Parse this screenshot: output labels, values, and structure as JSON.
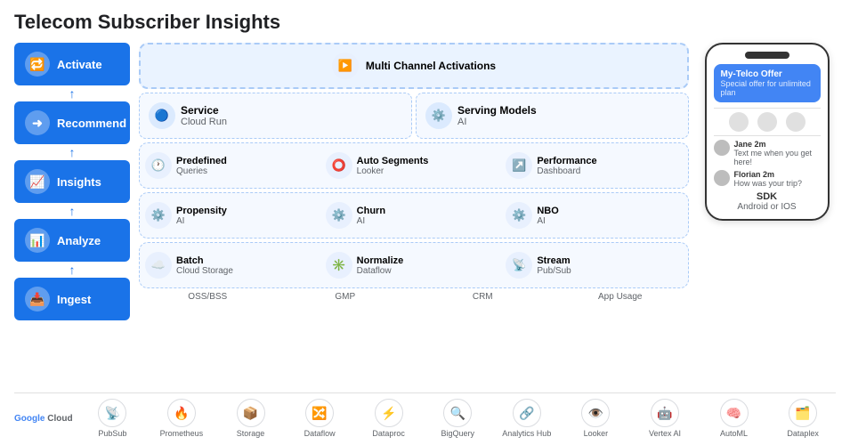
{
  "title": "Telecom Subscriber Insights",
  "sidebar": {
    "buttons": [
      {
        "label": "Activate",
        "icon": "🔁",
        "id": "activate"
      },
      {
        "label": "Recommend",
        "icon": "➜",
        "id": "recommend"
      },
      {
        "label": "Insights",
        "icon": "📈",
        "id": "insights"
      },
      {
        "label": "Analyze",
        "icon": "📊",
        "id": "analyze"
      },
      {
        "label": "Ingest",
        "icon": "📥",
        "id": "ingest"
      }
    ]
  },
  "diagram": {
    "row1": {
      "label": "Multi Channel Activations",
      "icon": "▶"
    },
    "row2": {
      "service": {
        "label": "Service",
        "sublabel": "Cloud Run",
        "icon": "🔵"
      },
      "serving": {
        "label": "Serving Models",
        "sublabel": "AI",
        "icon": "⚙️"
      }
    },
    "row3": {
      "predefined": {
        "label": "Predefined",
        "sublabel": "Queries",
        "icon": "🕐"
      },
      "autoSegments": {
        "label": "Auto Segments",
        "sublabel": "Looker",
        "icon": "⭕"
      },
      "performance": {
        "label": "Performance",
        "sublabel": "Dashboard",
        "icon": "↗"
      }
    },
    "row4": {
      "propensity": {
        "label": "Propensity",
        "sublabel": "AI",
        "icon": "⚙️"
      },
      "churn": {
        "label": "Churn",
        "sublabel": "AI",
        "icon": "⚙️"
      },
      "nbo": {
        "label": "NBO",
        "sublabel": "AI",
        "icon": "⚙️"
      }
    },
    "row5": {
      "batch": {
        "label": "Batch",
        "sublabel": "Cloud Storage",
        "icon": "☁️"
      },
      "normalize": {
        "label": "Normalize",
        "sublabel": "Dataflow",
        "icon": "✳️"
      },
      "stream": {
        "label": "Stream",
        "sublabel": "Pub/Sub",
        "icon": "📡"
      }
    },
    "sourceLabels": [
      "OSS/BSS",
      "GMP",
      "CRM",
      "App Usage"
    ]
  },
  "phone": {
    "offer": {
      "title": "My-Telco Offer",
      "sub": "Special offer for unlimited plan"
    },
    "messages": [
      {
        "name": "Jane 2m",
        "text": "Text me when you get here!"
      },
      {
        "name": "Florian 2m",
        "text": "How was your trip?"
      }
    ],
    "sdk": "SDK",
    "os": "Android or IOS"
  },
  "bottomIcons": [
    {
      "label": "PubSub",
      "icon": "📡"
    },
    {
      "label": "Prometheus",
      "icon": "🔥"
    },
    {
      "label": "Storage",
      "icon": "📦"
    },
    {
      "label": "Dataflow",
      "icon": "🔀"
    },
    {
      "label": "Dataproc",
      "icon": "⚡"
    },
    {
      "label": "BigQuery",
      "icon": "🔍"
    },
    {
      "label": "Analytics Hub",
      "icon": "🔗"
    },
    {
      "label": "Looker",
      "icon": "👁️"
    },
    {
      "label": "Vertex AI",
      "icon": "🤖"
    },
    {
      "label": "AutoML",
      "icon": "🧠"
    },
    {
      "label": "Dataplex",
      "icon": "🗂️"
    }
  ],
  "googleCloudLogo": "Google Cloud"
}
